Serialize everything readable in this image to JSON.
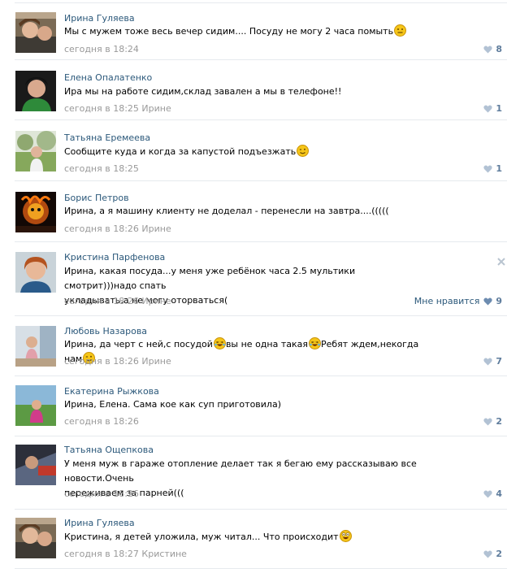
{
  "colors": {
    "author": "#2b587a",
    "meta": "#999999",
    "like": "#5e7c9c",
    "separator": "#e6eaee"
  },
  "comments": [
    {
      "author": "Ирина Гуляева",
      "text": "Мы с мужем тоже весь вечер сидим.... Посуду не могу 2 часа помыть",
      "text2": "",
      "emoji": "neutral-face-icon",
      "time": "сегодня в 18:24",
      "reply_to": "",
      "like_label": "",
      "likes": "8"
    },
    {
      "author": "Елена Опалатенко",
      "text": "Ира мы на работе сидим,склад завален а мы в телефоне!!",
      "text2": "",
      "emoji": "",
      "time": "сегодня в 18:25",
      "reply_to": "Ирине",
      "like_label": "",
      "likes": "1"
    },
    {
      "author": "Татьяна Еремеева",
      "text": "Сообщите куда и когда за капустой подъезжать",
      "text2": "",
      "emoji": "wink-face-icon",
      "time": "сегодня в 18:25",
      "reply_to": "",
      "like_label": "",
      "likes": "1"
    },
    {
      "author": "Борис Петров",
      "text": "Ирина, а я машину клиенту не доделал - перенесли на завтра....(((((",
      "text2": "",
      "emoji": "",
      "time": "сегодня в 18:26",
      "reply_to": "Ирине",
      "like_label": "",
      "likes": ""
    },
    {
      "author": "Кристина Парфенова",
      "text": "Ирина, какая посуда...у меня уже ребёнок часа 2.5 мультики смотрит)))надо спать",
      "text2": "укладывать,а не могу оторваться(",
      "emoji": "",
      "time": "сегодня в 18:26",
      "reply_to": "Ирине",
      "like_label": "Мне нравится",
      "likes": "9"
    },
    {
      "author": "Любовь Назарова",
      "text_parts": [
        "Ирина, да черт с ней,с посудой",
        "вы не одна такая",
        "Ребят ждем,некогда нам"
      ],
      "emoji_parts": [
        "laughing-face-icon",
        "laughing-face-icon",
        "wink-face-icon"
      ],
      "time": "сегодня в 18:26",
      "reply_to": "Ирине",
      "like_label": "",
      "likes": "7"
    },
    {
      "author": "Екатерина Рыжкова",
      "text": "Ирина, Елена. Сама кое как суп приготовила)",
      "text2": "",
      "emoji": "",
      "time": "сегодня в 18:26",
      "reply_to": "",
      "like_label": "",
      "likes": "2"
    },
    {
      "author": "Татьяна Ощепкова",
      "text": "У меня муж в гараже отопление делает так я бегаю ему рассказываю все новости.Очень",
      "text2": "переживаем за парней(((",
      "emoji": "",
      "time": "сегодня в 18:26",
      "reply_to": "",
      "like_label": "",
      "likes": "4"
    },
    {
      "author": "Ирина Гуляева",
      "text": "Кристина, я детей уложила, муж читал... Что происходит",
      "text2": "",
      "emoji": "shocked-face-icon",
      "time": "сегодня в 18:27",
      "reply_to": "Кристине",
      "like_label": "",
      "likes": "2"
    }
  ]
}
